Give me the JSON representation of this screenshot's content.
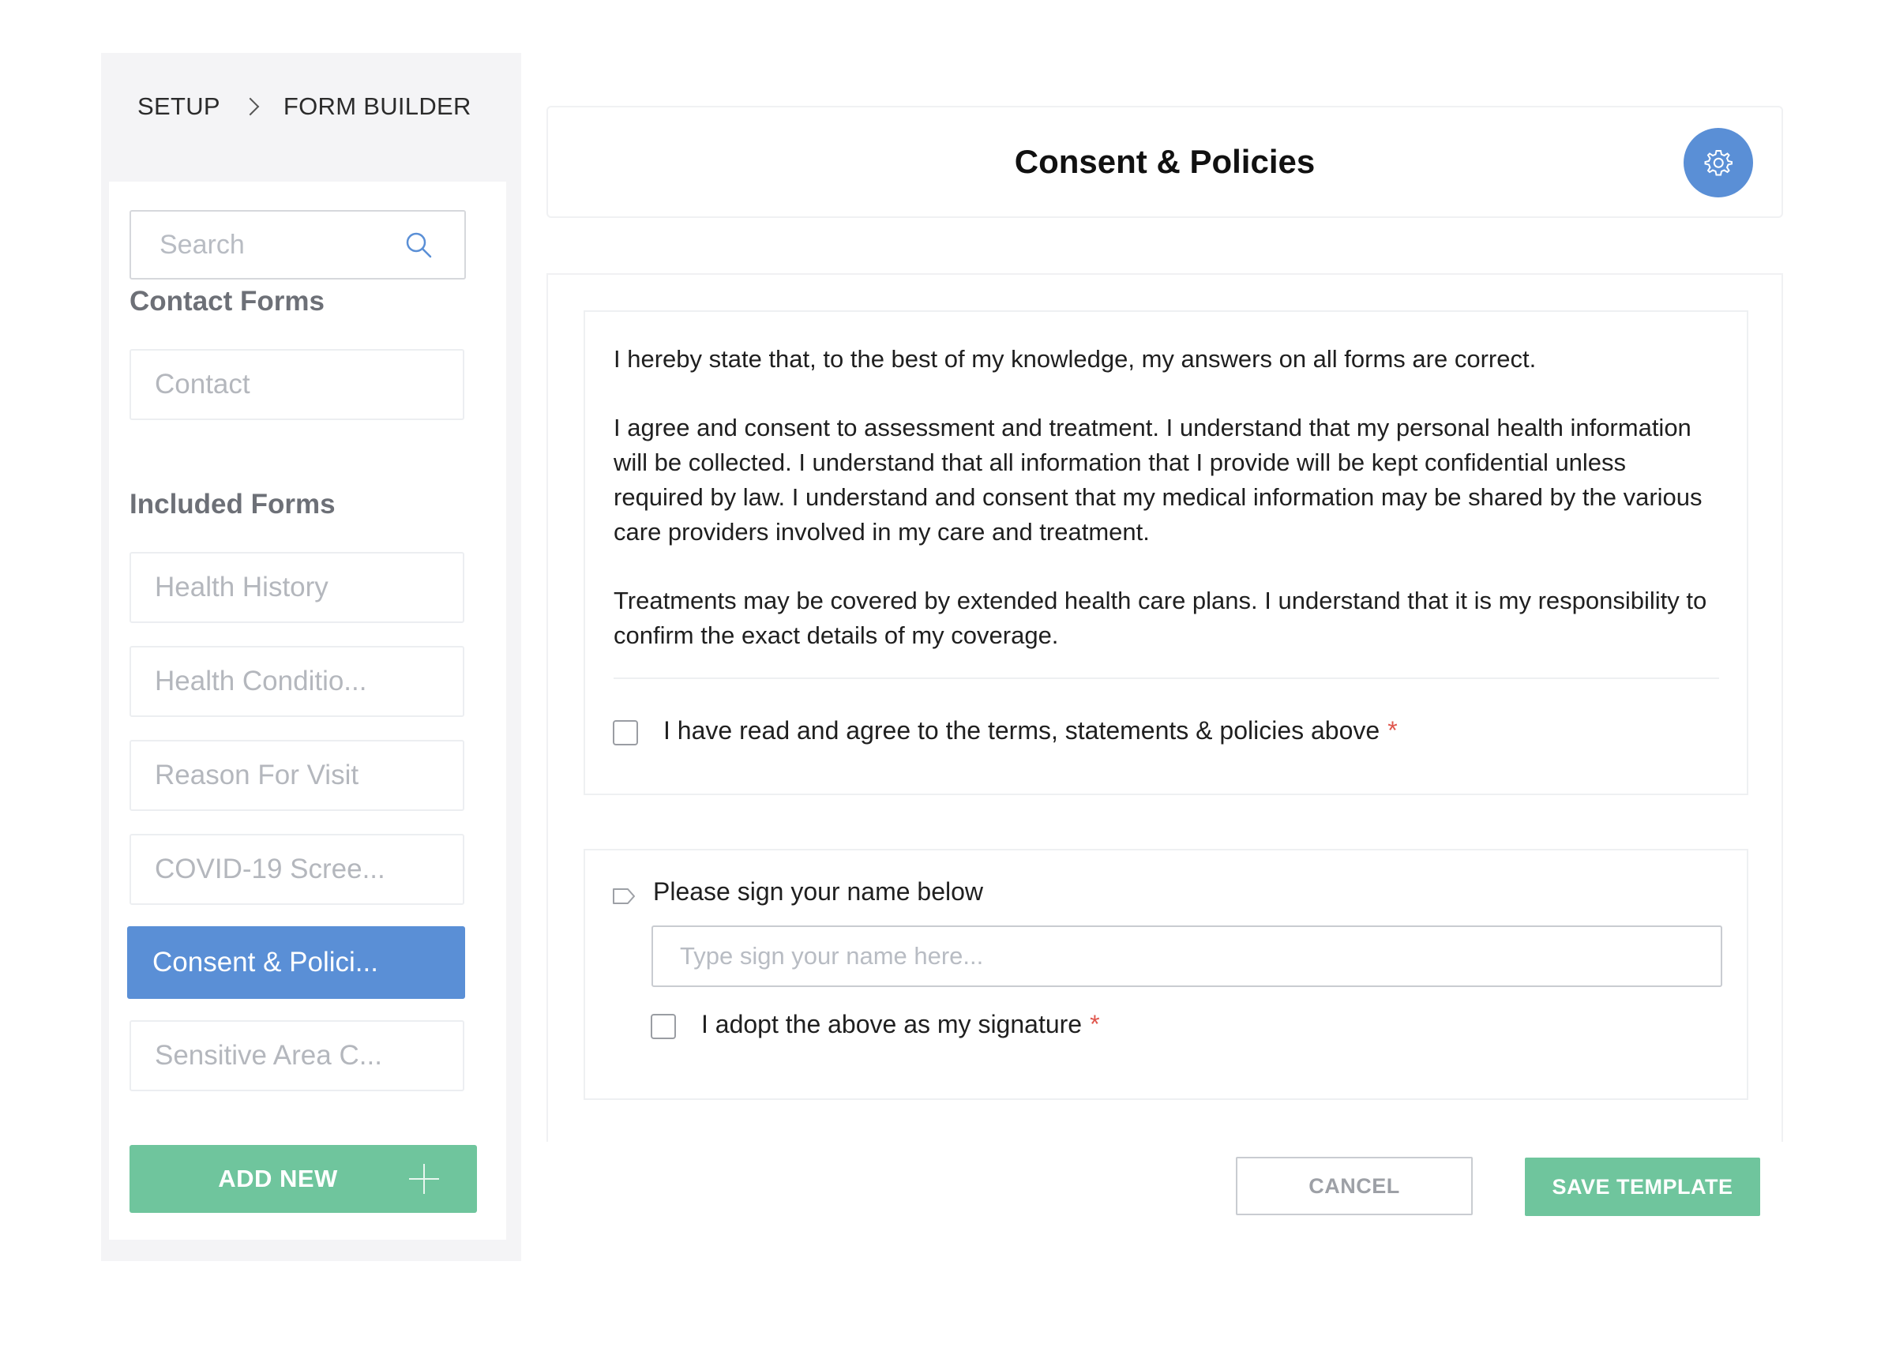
{
  "breadcrumb": {
    "items": [
      "SETUP",
      "FORM BUILDER"
    ]
  },
  "sidebar": {
    "search": {
      "placeholder": "Search",
      "value": ""
    },
    "contact_section_title": "Contact Forms",
    "contact_items": [
      {
        "label": "Contact"
      }
    ],
    "included_section_title": "Included Forms",
    "included_items": [
      {
        "label": "Health History",
        "active": false
      },
      {
        "label": "Health Conditio...",
        "active": false
      },
      {
        "label": "Reason For Visit",
        "active": false
      },
      {
        "label": "COVID-19 Scree...",
        "active": false
      },
      {
        "label": "Consent & Polici...",
        "active": true
      },
      {
        "label": "Sensitive Area C...",
        "active": false
      }
    ],
    "add_new_label": "ADD NEW"
  },
  "header": {
    "title": "Consent & Policies"
  },
  "consent": {
    "paragraphs": [
      "I hereby state that, to the best of my knowledge, my answers on all forms are correct.",
      "I agree and consent to assessment and treatment. I understand that my personal health information will be collected. I understand that all information that I provide will be kept confidential unless required by law. I understand and consent that my medical information may be shared by the various care providers involved in my care and treatment.",
      "Treatments may be covered by extended health care plans. I understand that it is my responsibility to confirm the exact details of my coverage."
    ],
    "agree_label": "I have read and agree to the terms, statements & policies above",
    "agree_checked": false,
    "required_mark": "*"
  },
  "signature": {
    "label": "Please sign your name below",
    "placeholder": "Type sign your name here...",
    "value": "",
    "adopt_label": "I adopt the above as my signature",
    "adopt_checked": false,
    "required_mark": "*"
  },
  "actions": {
    "cancel_label": "CANCEL",
    "save_label": "SAVE TEMPLATE"
  },
  "colors": {
    "accent_blue": "#5a8fd6",
    "accent_green": "#6fc59d",
    "required_red": "#e0564d"
  },
  "icons": [
    "search-icon",
    "chevron-right-icon",
    "gear-icon",
    "plus-icon",
    "tag-icon"
  ]
}
